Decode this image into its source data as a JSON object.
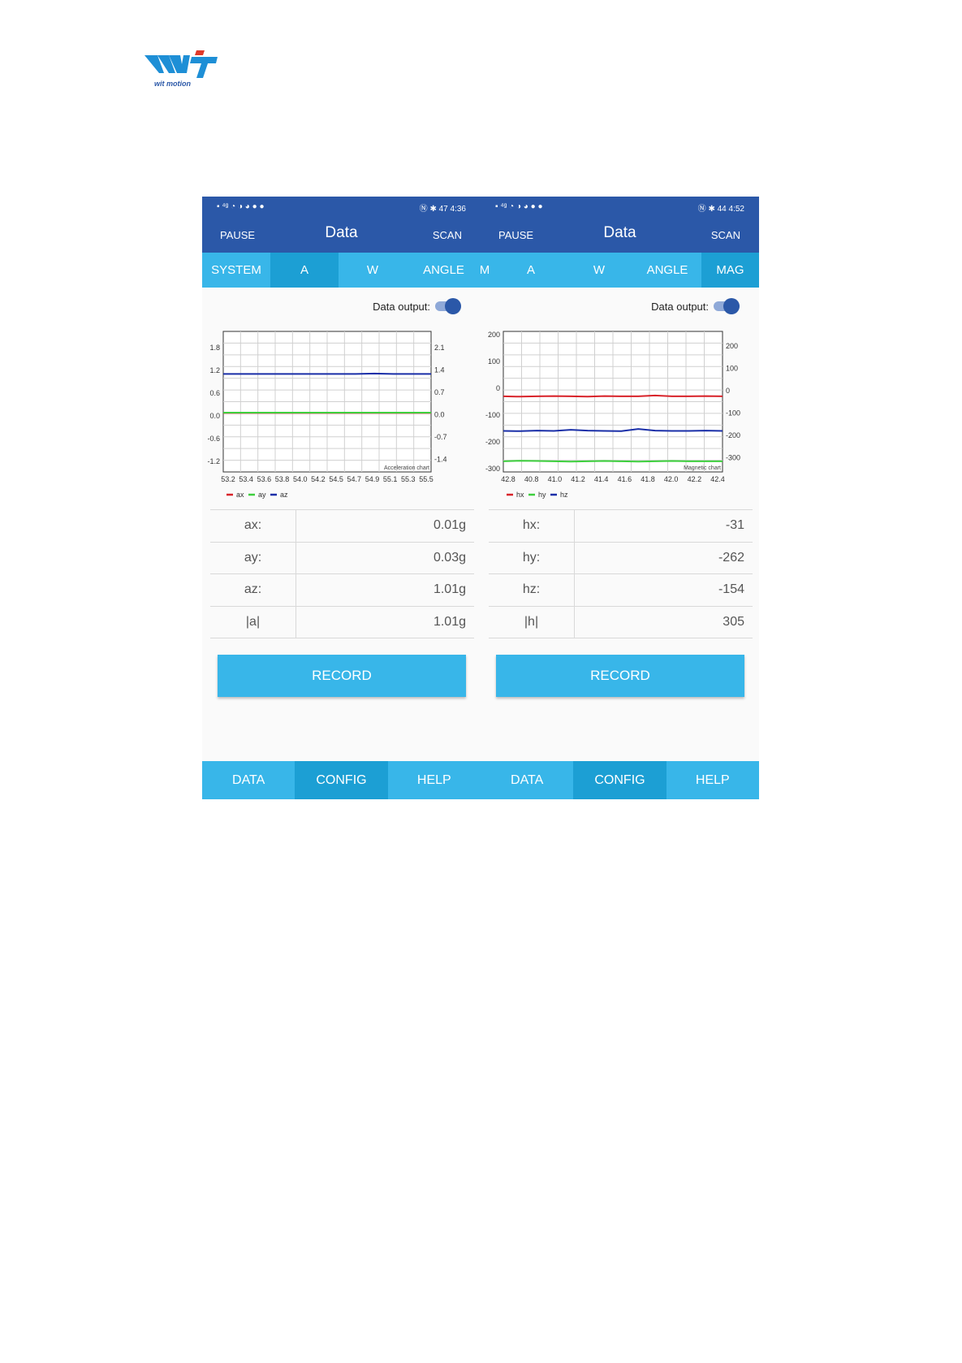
{
  "brand": {
    "logo_text": "WIT",
    "logo_subtext": "wit motion"
  },
  "colors": {
    "primary": "#2b58a8",
    "tab": "#38b6e9",
    "tab_active": "#1c9fd4",
    "red": "#d8232a",
    "green": "#3ecf3e",
    "blue": "#1a2fa8"
  },
  "left": {
    "status": {
      "time": "4:36",
      "battery": "47"
    },
    "appbar": {
      "pause": "PAUSE",
      "title": "Data",
      "scan": "SCAN"
    },
    "tabs": [
      {
        "label": "SYSTEM"
      },
      {
        "label": "A"
      },
      {
        "label": "W"
      },
      {
        "label": "ANGLE"
      }
    ],
    "toggle_label": "Data output:",
    "readings": [
      {
        "key": "ax:",
        "value": "0.01g"
      },
      {
        "key": "ay:",
        "value": "0.03g"
      },
      {
        "key": "az:",
        "value": "1.01g"
      },
      {
        "key": "|a|",
        "value": "1.01g"
      }
    ],
    "record": "RECORD",
    "bottom_tabs": [
      {
        "label": "DATA"
      },
      {
        "label": "CONFIG"
      },
      {
        "label": "HELP"
      }
    ]
  },
  "right": {
    "status": {
      "time": "4:52",
      "battery": "44"
    },
    "appbar": {
      "pause": "PAUSE",
      "title": "Data",
      "scan": "SCAN"
    },
    "tabs": [
      {
        "label": "EM"
      },
      {
        "label": "A"
      },
      {
        "label": "W"
      },
      {
        "label": "ANGLE"
      },
      {
        "label": "MAG"
      }
    ],
    "toggle_label": "Data output:",
    "readings": [
      {
        "key": "hx:",
        "value": "-31"
      },
      {
        "key": "hy:",
        "value": "-262"
      },
      {
        "key": "hz:",
        "value": "-154"
      },
      {
        "key": "|h|",
        "value": "305"
      }
    ],
    "record": "RECORD",
    "bottom_tabs": [
      {
        "label": "DATA"
      },
      {
        "label": "CONFIG"
      },
      {
        "label": "HELP"
      }
    ]
  },
  "chart_data": [
    {
      "type": "line",
      "title": "Acceleration chart",
      "x_ticks": [
        "53.2",
        "53.4",
        "53.6",
        "53.8",
        "54.0",
        "54.2",
        "54.5",
        "54.7",
        "54.9",
        "55.1",
        "55.3",
        "55.5"
      ],
      "y_left_ticks": [
        "1.8",
        "1.2",
        "0.6",
        "0.0",
        "-0.6",
        "-1.2"
      ],
      "y_right_ticks": [
        "2.1",
        "1.4",
        "0.7",
        "0.0",
        "-0.7",
        "-1.4"
      ],
      "ylim": [
        -1.5,
        2.1
      ],
      "series": [
        {
          "name": "ax",
          "color": "#d8232a",
          "values": [
            0.01,
            0.01,
            0.01,
            0.01,
            0.01,
            0.01,
            0.01,
            0.01,
            0.01,
            0.01,
            0.01,
            0.01
          ]
        },
        {
          "name": "ay",
          "color": "#3ecf3e",
          "values": [
            0.02,
            0.02,
            0.02,
            0.02,
            0.02,
            0.02,
            0.02,
            0.02,
            0.02,
            0.02,
            0.02,
            0.02
          ]
        },
        {
          "name": "az",
          "color": "#1a2fa8",
          "values": [
            1.01,
            1.01,
            1.01,
            1.01,
            1.01,
            1.01,
            1.01,
            1.01,
            1.02,
            1.01,
            1.01,
            1.01
          ]
        }
      ],
      "grid": true,
      "legend": "bottom-left"
    },
    {
      "type": "line",
      "title": "Magnetic chart",
      "x_ticks": [
        "42.8",
        "40.8",
        "41.0",
        "41.2",
        "41.4",
        "41.6",
        "41.8",
        "42.0",
        "42.2",
        "42.4"
      ],
      "y_left_ticks": [
        "200",
        "100",
        "0",
        "-100",
        "-200",
        "-300"
      ],
      "y_right_ticks": [
        "200",
        "100",
        "0",
        "-100",
        "-200",
        "-300"
      ],
      "ylim": [
        -300,
        200
      ],
      "series": [
        {
          "name": "hx",
          "color": "#d8232a",
          "values": [
            -31,
            -32,
            -31,
            -30,
            -31,
            -32,
            -30,
            -31,
            -31,
            -28,
            -31,
            -31,
            -30,
            -31
          ]
        },
        {
          "name": "hy",
          "color": "#3ecf3e",
          "values": [
            -262,
            -260,
            -261,
            -262,
            -263,
            -262,
            -261,
            -262,
            -263,
            -262,
            -261,
            -262,
            -262,
            -262
          ]
        },
        {
          "name": "hz",
          "color": "#1a2fa8",
          "values": [
            -154,
            -155,
            -153,
            -154,
            -150,
            -153,
            -154,
            -155,
            -147,
            -153,
            -154,
            -154,
            -153,
            -154
          ]
        }
      ],
      "grid": true,
      "legend": "bottom-left"
    }
  ]
}
